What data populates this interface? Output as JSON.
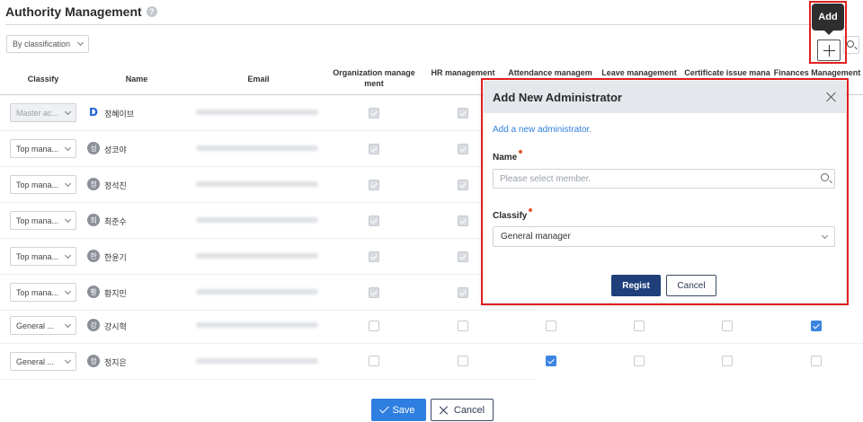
{
  "page": {
    "title": "Authority Management",
    "help_icon": "?",
    "filter": "By classification"
  },
  "toolbar": {
    "add_tooltip": "Add"
  },
  "table": {
    "headers": {
      "classify": "Classify",
      "name": "Name",
      "email": "Email",
      "org_line1": "Organization manage",
      "org_line2": "ment",
      "hr": "HR management",
      "attendance": "Attendance managem",
      "leave": "Leave management",
      "certificate": "Certificate issue mana",
      "finances": "Finances Management"
    },
    "rows": [
      {
        "classify": "Master ac...",
        "avatar": "D",
        "name": "정혜이브"
      },
      {
        "classify": "Top mana...",
        "avatar": "성",
        "name": "성코야"
      },
      {
        "classify": "Top mana...",
        "avatar": "정",
        "name": "정석진"
      },
      {
        "classify": "Top mana...",
        "avatar": "최",
        "name": "최준수"
      },
      {
        "classify": "Top mana...",
        "avatar": "한",
        "name": "한윤기"
      },
      {
        "classify": "Top mana...",
        "avatar": "황",
        "name": "황지민"
      },
      {
        "classify": "General ...",
        "avatar": "강",
        "name": "강시혁"
      },
      {
        "classify": "General ...",
        "avatar": "정",
        "name": "정지은"
      }
    ]
  },
  "footer": {
    "save": "Save",
    "cancel": "Cancel"
  },
  "modal": {
    "title": "Add New Administrator",
    "description": "Add a new administrator.",
    "name_label": "Name",
    "name_placeholder": "Please select member.",
    "classify_label": "Classify",
    "classify_value": "General manager",
    "regist": "Regist",
    "cancel": "Cancel"
  },
  "colors": {
    "accent": "#2f7fe0",
    "highlight": "#e02020",
    "modal_primary": "#1e3f7a"
  }
}
